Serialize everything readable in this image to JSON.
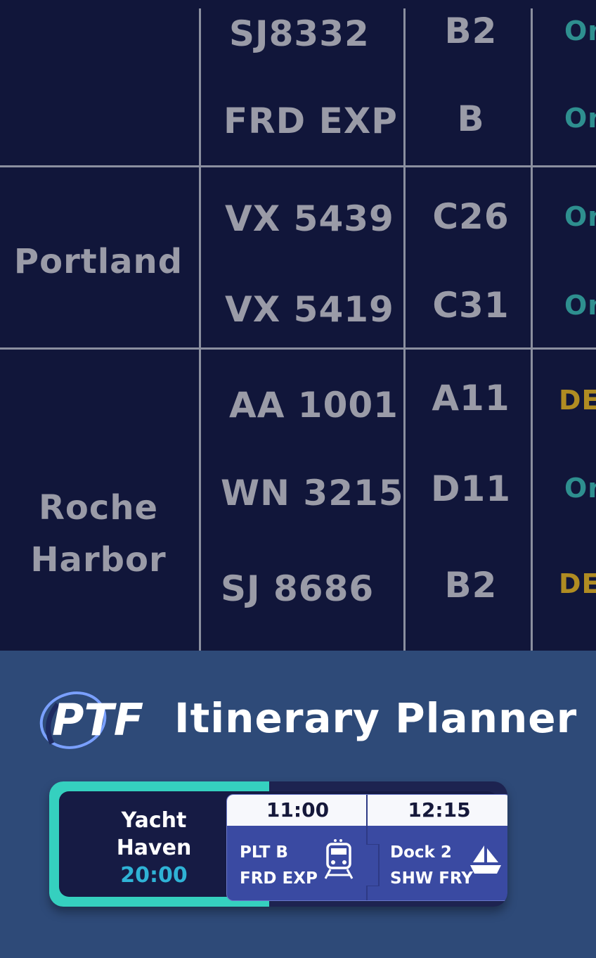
{
  "board": {
    "rows": [
      {
        "destination": "",
        "flights": [
          {
            "flight": "SJ8332",
            "gate": "B2",
            "status": "On",
            "status_kind": "on"
          },
          {
            "flight": "FRD EXP",
            "gate": "B",
            "status": "On",
            "status_kind": "on"
          }
        ]
      },
      {
        "destination": "Portland",
        "flights": [
          {
            "flight": "VX 5439",
            "gate": "C26",
            "status": "On",
            "status_kind": "on"
          },
          {
            "flight": "VX 5419",
            "gate": "C31",
            "status": "On",
            "status_kind": "on"
          }
        ]
      },
      {
        "destination_lines": [
          "Roche",
          "Harbor"
        ],
        "flights": [
          {
            "flight": "AA 1001",
            "gate": "A11",
            "status": "DE",
            "status_kind": "delayed"
          },
          {
            "flight": "WN 3215",
            "gate": "D11",
            "status": "On",
            "status_kind": "on"
          },
          {
            "flight": "SJ 8686",
            "gate": "B2",
            "status": "DE",
            "status_kind": "delayed"
          }
        ]
      }
    ],
    "colors": {
      "on_time": "#2e8f8f",
      "delayed": "#b08c22",
      "text": "#9a9ba7",
      "background": "#11163a"
    }
  },
  "planner": {
    "logo_text": "PTF",
    "title": "Itinerary Planner",
    "itinerary": {
      "origin": [
        "Yacht",
        "Haven"
      ],
      "origin_time": "20:00",
      "progress": 0.48,
      "legs": [
        {
          "time": "11:00",
          "line1": "PLT B",
          "line2": "FRD EXP",
          "icon": "train-icon"
        },
        {
          "time": "12:15",
          "line1": "Dock 2",
          "line2": "SHW FRY",
          "icon": "sailboat-icon"
        }
      ]
    },
    "colors": {
      "panel": "#2e4a78",
      "accent": "#35d0bf",
      "time": "#2fb3d6"
    }
  }
}
